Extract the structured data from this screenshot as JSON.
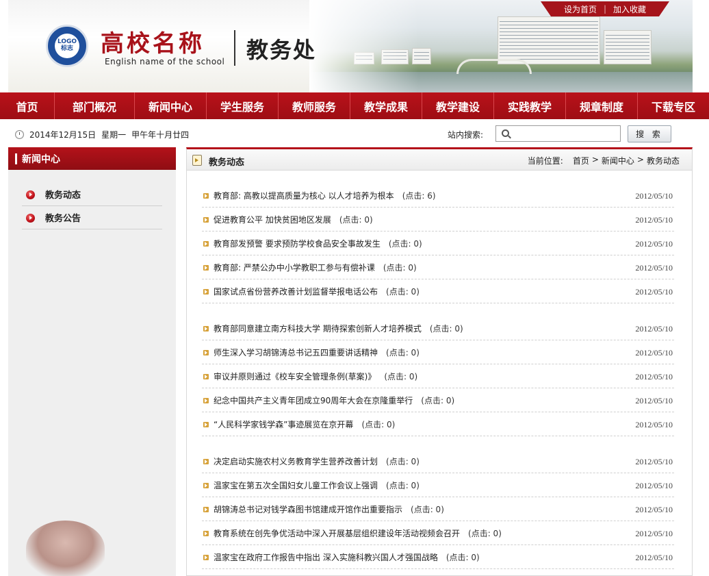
{
  "header": {
    "top_links": [
      "设为首页",
      "加入收藏"
    ],
    "top_links_separator": "|",
    "logo_text_line1": "LOGO",
    "logo_text_line2": "标志",
    "school_name": "高校名称",
    "school_name_en": "English name of the school",
    "department": "教务处"
  },
  "nav": [
    "首页",
    "部门概况",
    "新闻中心",
    "学生服务",
    "教师服务",
    "教学成果",
    "教学建设",
    "实践教学",
    "规章制度",
    "下载专区"
  ],
  "infobar": {
    "date": "2014年12月15日",
    "weekday": "星期一",
    "lunar": "甲午年十月廿四",
    "search_label": "站内搜索:",
    "search_value": "",
    "search_button": "搜 索"
  },
  "sidebar": {
    "title": "新闻中心",
    "items": [
      "教务动态",
      "教务公告"
    ]
  },
  "main": {
    "title": "教务动态",
    "breadcrumb_label": "当前位置:",
    "breadcrumb": [
      "首页",
      ">",
      "新闻中心",
      ">",
      "教务动态"
    ],
    "groups": [
      [
        {
          "title": "教育部: 高教以提高质量为核心 以人才培养为根本",
          "hits": "(点击: 6)",
          "date": "2012/05/10"
        },
        {
          "title": "促进教育公平 加快贫困地区发展",
          "hits": "(点击: 0)",
          "date": "2012/05/10"
        },
        {
          "title": "教育部发预警 要求预防学校食品安全事故发生",
          "hits": "(点击: 0)",
          "date": "2012/05/10"
        },
        {
          "title": "教育部: 严禁公办中小学教职工参与有偿补课",
          "hits": "(点击: 0)",
          "date": "2012/05/10"
        },
        {
          "title": "国家试点省份营养改善计划监督举报电话公布",
          "hits": "(点击: 0)",
          "date": "2012/05/10"
        }
      ],
      [
        {
          "title": "教育部同意建立南方科技大学 期待探索创新人才培养模式",
          "hits": "(点击: 0)",
          "date": "2012/05/10"
        },
        {
          "title": "师生深入学习胡锦涛总书记五四重要讲话精神",
          "hits": "(点击: 0)",
          "date": "2012/05/10"
        },
        {
          "title": "审议并原则通过《校车安全管理条例(草案)》",
          "hits": "(点击: 0)",
          "date": "2012/05/10"
        },
        {
          "title": "纪念中国共产主义青年团成立90周年大会在京隆重举行",
          "hits": "(点击: 0)",
          "date": "2012/05/10"
        },
        {
          "title": "“人民科学家钱学森”事迹展览在京开幕",
          "hits": "(点击: 0)",
          "date": "2012/05/10"
        }
      ],
      [
        {
          "title": "决定启动实施农村义务教育学生营养改善计划",
          "hits": "(点击: 0)",
          "date": "2012/05/10"
        },
        {
          "title": "温家宝在第五次全国妇女儿童工作会议上强调",
          "hits": "(点击: 0)",
          "date": "2012/05/10"
        },
        {
          "title": "胡锦涛总书记对钱学森图书馆建成开馆作出重要指示",
          "hits": "(点击: 0)",
          "date": "2012/05/10"
        },
        {
          "title": "教育系统在创先争优活动中深入开展基层组织建设年活动视频会召开",
          "hits": "(点击: 0)",
          "date": "2012/05/10"
        },
        {
          "title": "温家宝在政府工作报告中指出 深入实施科教兴国人才强国战略",
          "hits": "(点击: 0)",
          "date": "2012/05/10"
        }
      ]
    ]
  },
  "colors": {
    "brand_red": "#a8121a",
    "bullet_gold": "#d7a23a"
  }
}
